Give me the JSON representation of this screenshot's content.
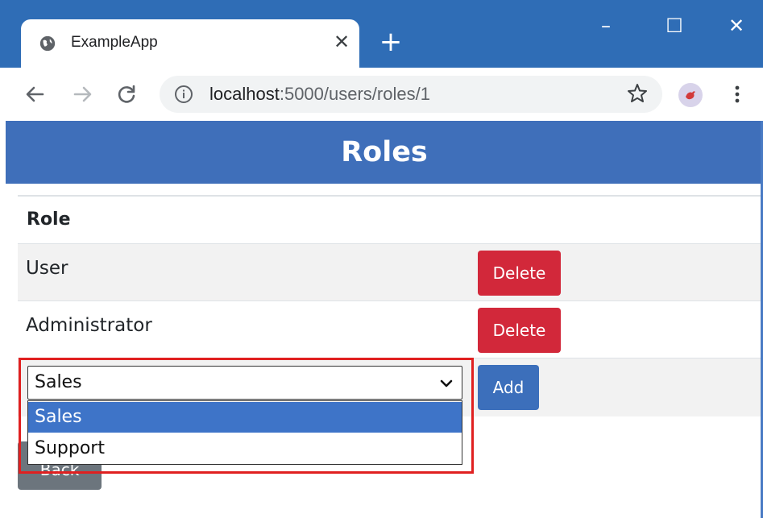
{
  "browser": {
    "tab_title": "ExampleApp",
    "new_tab_label": "+",
    "url_host": "localhost",
    "url_path": ":5000/users/roles/1",
    "window_controls": {
      "minimize": "–",
      "maximize": "☐",
      "close": "✕"
    }
  },
  "page": {
    "title": "Roles",
    "table": {
      "header": "Role",
      "rows": [
        {
          "name": "User",
          "action": "Delete"
        },
        {
          "name": "Administrator",
          "action": "Delete"
        }
      ]
    },
    "add_row": {
      "select_value": "Sales",
      "options": [
        "Sales",
        "Support"
      ],
      "add_label": "Add"
    },
    "back_label": "Back"
  },
  "colors": {
    "header_bg": "#3f6fba",
    "danger": "#d2283a",
    "primary": "#3c6fbb",
    "secondary": "#6c757d",
    "highlight": "#e02020",
    "chrome_bg": "#2f6db6"
  }
}
